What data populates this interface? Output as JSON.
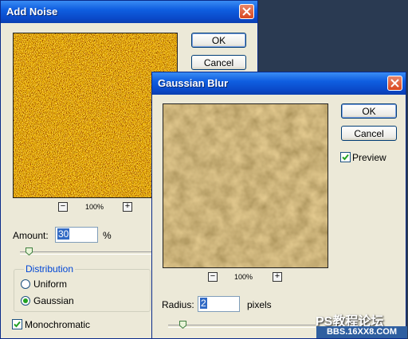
{
  "add_noise": {
    "title": "Add Noise",
    "ok_label": "OK",
    "cancel_label": "Cancel",
    "zoom_out": "−",
    "zoom_level": "100%",
    "zoom_in": "+",
    "amount_label": "Amount:",
    "amount_value": "30",
    "amount_unit": "%",
    "distribution_label": "Distribution",
    "uniform_label": "Uniform",
    "gaussian_label": "Gaussian",
    "distribution_selected": "Gaussian",
    "monochromatic_label": "Monochromatic",
    "monochromatic_checked": true
  },
  "gaussian_blur": {
    "title": "Gaussian Blur",
    "ok_label": "OK",
    "cancel_label": "Cancel",
    "preview_label": "Preview",
    "preview_checked": true,
    "zoom_out": "−",
    "zoom_level": "100%",
    "zoom_in": "+",
    "radius_label": "Radius:",
    "radius_value": "2",
    "radius_unit": "pixels"
  },
  "watermark": {
    "line1": "PS教程论坛",
    "line2": "BBS.16XX8.COM"
  },
  "colors": {
    "title_bar": "#0a48c8",
    "dialog_bg": "#ece9d8",
    "close_button": "#d9461e",
    "noise_base": "#8a6a20",
    "blur_base": "#a08040"
  }
}
